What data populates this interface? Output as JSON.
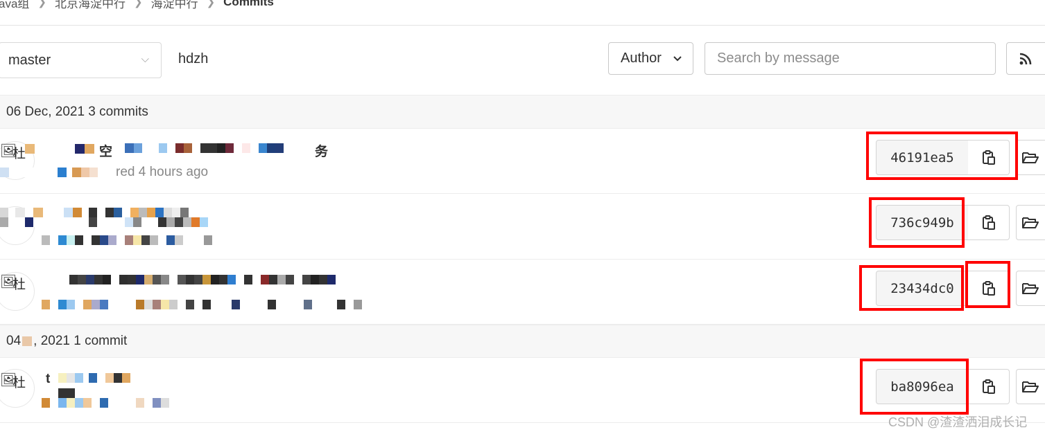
{
  "breadcrumb": {
    "items": [
      "ava组",
      "北京海淀中行",
      "海淀中行",
      "Commits"
    ]
  },
  "toolbar": {
    "branch": "master",
    "path": "hdzh",
    "author_label": "Author",
    "search_placeholder": "Search by message"
  },
  "groups": [
    {
      "date_label": "06 Dec, 2021 3 commits",
      "commits": [
        {
          "avatar_alt": "杜",
          "title_fragment": "空",
          "title_suffix": "务",
          "author_suffix": "red 4 hours ago",
          "sha": "46191ea5"
        },
        {
          "avatar_alt": "",
          "title_fragment": "",
          "title_suffix": "",
          "author_suffix": "",
          "sha": "736c949b"
        },
        {
          "avatar_alt": "杜",
          "title_fragment": "",
          "title_suffix": "",
          "author_suffix": "",
          "sha": "23434dc0"
        }
      ]
    },
    {
      "date_label": "04 ",
      "date_suffix": ", 2021 1 commit",
      "commits": [
        {
          "avatar_alt": "杜",
          "title_fragment": "t",
          "title_suffix": "",
          "author_suffix": "",
          "sha": "ba8096ea"
        }
      ]
    }
  ],
  "watermark": "CSDN @渣渣洒泪成长记",
  "colors": {
    "highlight": "#ff0000",
    "day_header_bg": "#f7f7f7",
    "sha_bg": "#f5f5f5"
  },
  "icons": {
    "copy": "clipboard-icon",
    "browse": "folder-open-icon",
    "rss": "rss-icon",
    "chevron": "chevron-down-icon"
  }
}
